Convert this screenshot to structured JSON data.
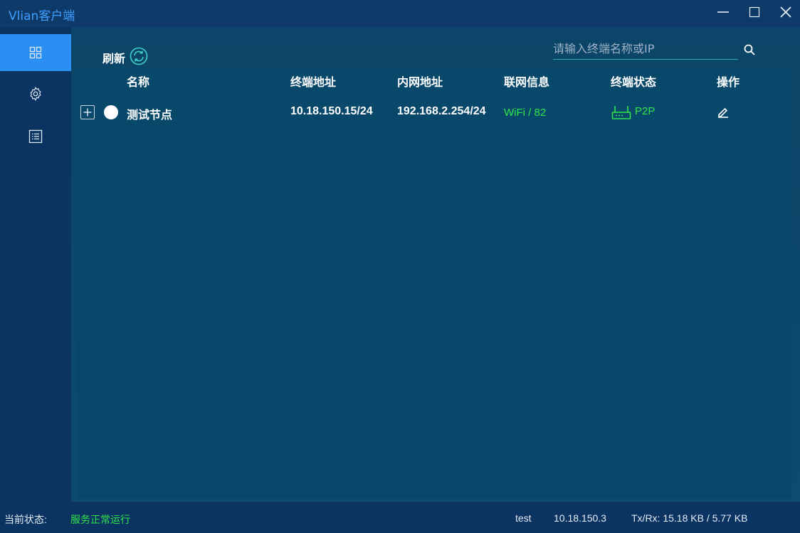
{
  "app": {
    "title": "Vlian客户端"
  },
  "window_controls": {
    "minimize": "minimize-icon",
    "maximize": "maximize-icon",
    "close": "close-icon"
  },
  "sidebar": {
    "items": [
      {
        "icon": "grid-icon",
        "active": true
      },
      {
        "icon": "gear-icon",
        "active": false
      },
      {
        "icon": "list-icon",
        "active": false
      }
    ]
  },
  "toolbar": {
    "refresh_label": "刷新"
  },
  "search": {
    "placeholder": "请输入终端名称或IP",
    "value": ""
  },
  "table": {
    "headers": {
      "name": "名称",
      "terminal_addr": "终端地址",
      "lan_addr": "内网地址",
      "network_info": "联网信息",
      "terminal_status": "终端状态",
      "actions": "操作"
    },
    "rows": [
      {
        "name": "测试节点",
        "terminal_addr": "10.18.150.15/24",
        "lan_addr": "192.168.2.254/24",
        "network_info": "WiFi / 82",
        "terminal_status": "P2P"
      }
    ]
  },
  "statusbar": {
    "status_label": "当前状态:",
    "status_value": "服务正常运行",
    "user": "test",
    "ip": "10.18.150.3",
    "txrx": "Tx/Rx: 15.18 KB / 5.77 KB"
  },
  "colors": {
    "accent": "#2a8ff2",
    "ok": "#2ee44a",
    "title": "#3fa0ff"
  }
}
